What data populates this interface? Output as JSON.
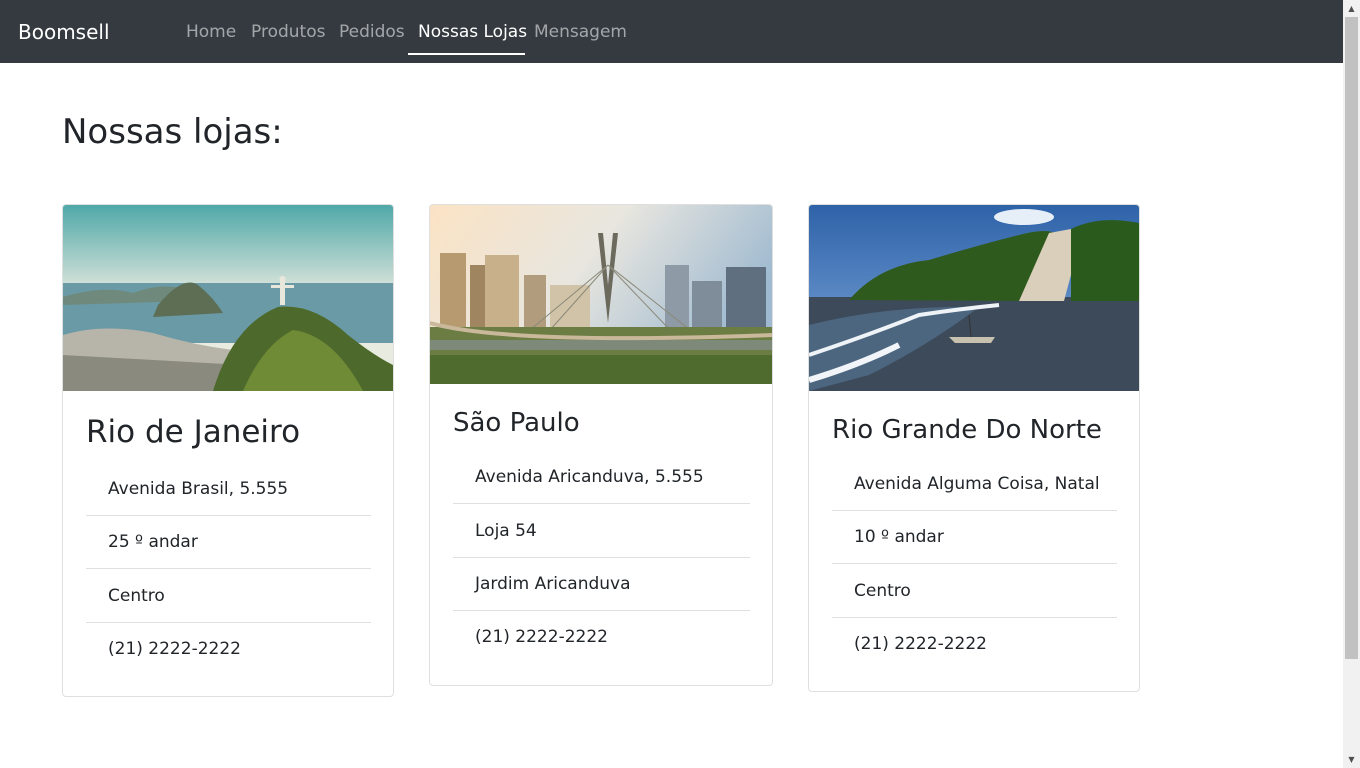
{
  "navbar": {
    "brand": "Boomsell",
    "links": [
      {
        "label": "Home"
      },
      {
        "label": "Produtos"
      },
      {
        "label": "Pedidos"
      },
      {
        "label": "Nossas Lojas",
        "active": true
      },
      {
        "label": "Mensagem"
      }
    ]
  },
  "page": {
    "title": "Nossas lojas:"
  },
  "stores": [
    {
      "name": "Rio de Janeiro",
      "address": "Avenida Brasil, 5.555",
      "detail": "25 º andar",
      "district": "Centro",
      "phone": "(21) 2222-2222"
    },
    {
      "name": "São Paulo",
      "address": "Avenida Aricanduva, 5.555",
      "detail": "Loja 54",
      "district": "Jardim Aricanduva",
      "phone": "(21) 2222-2222"
    },
    {
      "name": "Rio Grande Do Norte",
      "address": "Avenida Alguma Coisa, Natal",
      "detail": "10 º andar",
      "district": "Centro",
      "phone": "(21) 2222-2222"
    }
  ]
}
